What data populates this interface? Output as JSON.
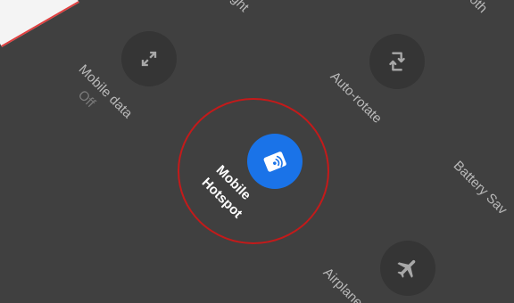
{
  "tiles": {
    "flashlight": {
      "label_partial": "light"
    },
    "bluetooth": {
      "label_partial": "ooth"
    },
    "mobile_data": {
      "label": "Mobile data",
      "status": "Off",
      "icon": "mobile-data-icon"
    },
    "auto_rotate": {
      "label": "Auto-rotate",
      "icon": "auto-rotate-icon"
    },
    "mobile_hotspot": {
      "label_line1": "Mobile",
      "label_line2": "Hotspot",
      "icon": "hotspot-icon",
      "state": "on"
    },
    "battery_saver": {
      "label_partial": "Battery Sav"
    },
    "airplane_mode": {
      "label_partial": "Airplane",
      "icon": "airplane-icon"
    }
  },
  "colors": {
    "background": "#404040",
    "tile_inactive": "#353535",
    "tile_active": "#1a73e8",
    "highlight_ring": "#c41a1a"
  }
}
